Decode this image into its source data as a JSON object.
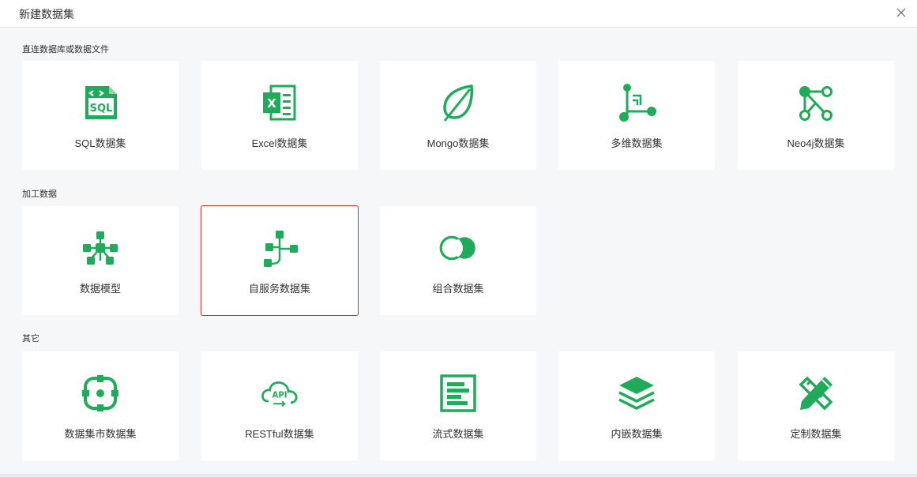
{
  "dialog": {
    "title": "新建数据集",
    "close_icon": "close-icon"
  },
  "colors": {
    "accent": "#1fab5a",
    "selected_border": "#d62b2b",
    "background": "#f5f7f8"
  },
  "sections": [
    {
      "title": "直连数据库或数据文件",
      "items": [
        {
          "label": "SQL数据集",
          "icon": "sql-file-icon"
        },
        {
          "label": "Excel数据集",
          "icon": "excel-file-icon"
        },
        {
          "label": "Mongo数据集",
          "icon": "mongo-leaf-icon"
        },
        {
          "label": "多维数据集",
          "icon": "multidimensional-icon"
        },
        {
          "label": "Neo4j数据集",
          "icon": "neo4j-graph-icon"
        }
      ]
    },
    {
      "title": "加工数据",
      "items": [
        {
          "label": "数据模型",
          "icon": "data-model-icon"
        },
        {
          "label": "自服务数据集",
          "icon": "self-service-icon",
          "selected": true
        },
        {
          "label": "组合数据集",
          "icon": "combine-circles-icon"
        }
      ]
    },
    {
      "title": "其它",
      "items": [
        {
          "label": "数据集市数据集",
          "icon": "data-mart-icon"
        },
        {
          "label": "RESTful数据集",
          "icon": "api-cloud-icon"
        },
        {
          "label": "流式数据集",
          "icon": "stream-icon"
        },
        {
          "label": "内嵌数据集",
          "icon": "embedded-layers-icon"
        },
        {
          "label": "定制数据集",
          "icon": "custom-pencil-ruler-icon"
        }
      ]
    }
  ]
}
